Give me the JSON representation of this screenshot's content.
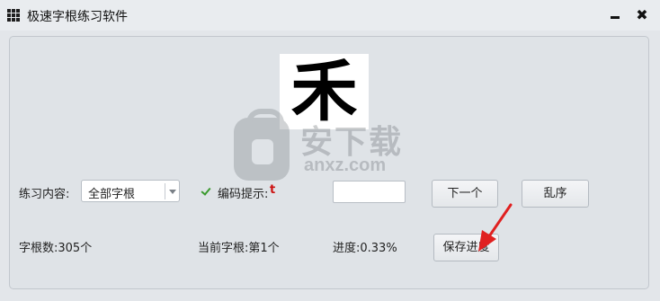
{
  "window": {
    "title": "极速字根练习软件",
    "icons": {
      "app": "grid-icon",
      "minimize": "minimize-icon",
      "close": "close-icon"
    },
    "close_glyph": "✖"
  },
  "display": {
    "current_char": "禾"
  },
  "watermark": {
    "text": "安下载",
    "sub": "anxz.com"
  },
  "controls": {
    "content_label": "练习内容:",
    "content_selected": "全部字根",
    "hint_label": "编码提示:",
    "hint_value": "t",
    "answer_value": "",
    "next_label": "下一个",
    "shuffle_label": "乱序",
    "save_label": "保存进度"
  },
  "status": {
    "count_text": "字根数:305个",
    "current_text": "当前字根:第1个",
    "progress_text": "进度:0.33%"
  },
  "colors": {
    "hint": "#cc1111",
    "check": "#3a9a2e",
    "arrow": "#e02020"
  }
}
